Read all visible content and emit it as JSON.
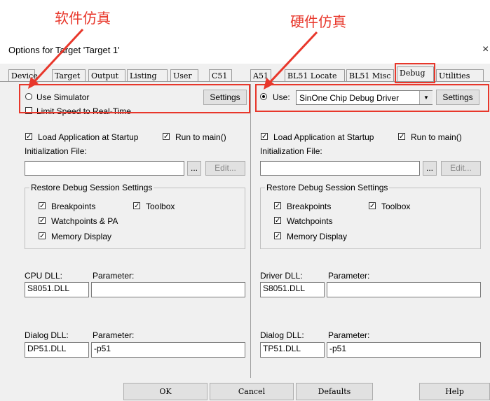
{
  "annotations": {
    "software_sim": "软件仿真",
    "hardware_sim": "硬件仿真"
  },
  "window": {
    "title": "Options for Target 'Target 1'",
    "close": "×"
  },
  "tabs": [
    "Device",
    "Target",
    "Output",
    "Listing",
    "User",
    "C51",
    "A51",
    "BL51 Locate",
    "BL51 Misc",
    "Debug",
    "Utilities"
  ],
  "active_tab": "Debug",
  "left": {
    "use_simulator": "Use Simulator",
    "limit_speed": "Limit Speed to Real-Time",
    "settings": "Settings",
    "load_app": "Load Application at Startup",
    "run_to_main": "Run to main()",
    "init_file_label": "Initialization File:",
    "init_file_value": "",
    "browse": "...",
    "edit": "Edit...",
    "restore_group": "Restore Debug Session Settings",
    "breakpoints": "Breakpoints",
    "toolbox": "Toolbox",
    "watchpoints": "Watchpoints & PA",
    "memory_display": "Memory Display",
    "dll_label": "CPU DLL:",
    "param_label": "Parameter:",
    "dll_value": "S8051.DLL",
    "param_value": "",
    "dialog_dll_label": "Dialog DLL:",
    "dialog_param_label": "Parameter:",
    "dialog_dll_value": "DP51.DLL",
    "dialog_param_value": "-p51"
  },
  "right": {
    "use": "Use:",
    "driver": "SinOne Chip Debug Driver",
    "settings": "Settings",
    "load_app": "Load Application at Startup",
    "run_to_main": "Run to main()",
    "init_file_label": "Initialization File:",
    "init_file_value": "",
    "browse": "...",
    "edit": "Edit...",
    "restore_group": "Restore Debug Session Settings",
    "breakpoints": "Breakpoints",
    "toolbox": "Toolbox",
    "watchpoints": "Watchpoints",
    "memory_display": "Memory Display",
    "dll_label": "Driver DLL:",
    "param_label": "Parameter:",
    "dll_value": "S8051.DLL",
    "param_value": "",
    "dialog_dll_label": "Dialog DLL:",
    "dialog_param_label": "Parameter:",
    "dialog_dll_value": "TP51.DLL",
    "dialog_param_value": "-p51"
  },
  "buttons": {
    "ok": "OK",
    "cancel": "Cancel",
    "defaults": "Defaults",
    "help": "Help"
  },
  "colors": {
    "annotation": "#e8372b",
    "dialog_bg": "#f0f0f0"
  }
}
